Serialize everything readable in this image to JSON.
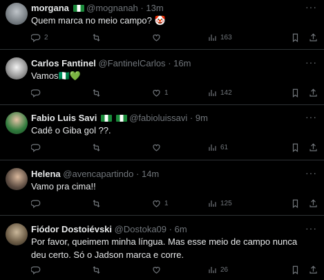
{
  "tweets": [
    {
      "name": "morgana",
      "handle": "@mognanah",
      "sep": "·",
      "time": "13m",
      "flag": true,
      "text": "Quem marca no meio campo? 🤡",
      "replies": "2",
      "retweets": "",
      "likes": "",
      "views": "163"
    },
    {
      "name": "Carlos Fantinel",
      "handle": "@FantinelCarlos",
      "sep": "·",
      "time": "16m",
      "flag": false,
      "text": "Vamos🇳🇬💚",
      "replies": "",
      "retweets": "",
      "likes": "1",
      "views": "142"
    },
    {
      "name": "Fabio Luis Savi",
      "handle": "@fabioluissavi",
      "sep": "·",
      "time": "9m",
      "flag": true,
      "text": "Cadê o Giba gol ??.",
      "replies": "",
      "retweets": "",
      "likes": "",
      "views": "61"
    },
    {
      "name": "Helena",
      "handle": "@avencapartindo",
      "sep": "·",
      "time": "14m",
      "flag": false,
      "text": "Vamo pra cima!!",
      "replies": "",
      "retweets": "",
      "likes": "1",
      "views": "125"
    },
    {
      "name": "Fiódor Dostoiévski",
      "handle": "@Dostoka09",
      "sep": "·",
      "time": "6m",
      "flag": false,
      "text": "Por favor, queimem minha língua. Mas esse meio de campo nunca deu certo. Só o Jadson marca e corre.",
      "replies": "",
      "retweets": "",
      "likes": "",
      "views": "26"
    }
  ],
  "more_label": "···",
  "colors": {
    "background": "#000000",
    "text": "#e7e9ea",
    "muted": "#71767b",
    "divider": "#2f3336"
  },
  "icons": [
    "reply-icon",
    "retweet-icon",
    "like-icon",
    "views-icon",
    "bookmark-icon",
    "share-icon"
  ]
}
